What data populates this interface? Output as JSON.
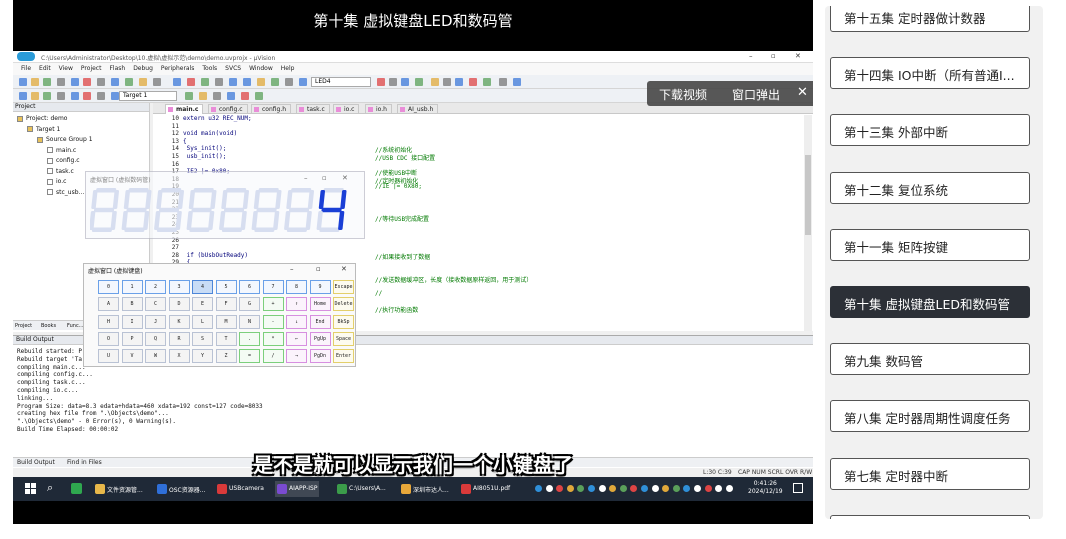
{
  "video": {
    "title": "第十集 虚拟键盘LED和数码管",
    "subtitle": "是不是就可以显示我们一个小键盘了",
    "controls": {
      "download": "下载视频",
      "popout": "窗口弹出",
      "close": "✕"
    }
  },
  "ide": {
    "window_title": "C:\\Users\\Administrator\\Desktop\\10.虚拟\\虚拟示范\\demo\\demo.uvprojx - µVision",
    "menu": [
      "File",
      "Edit",
      "View",
      "Project",
      "Flash",
      "Debug",
      "Peripherals",
      "Tools",
      "SVCS",
      "Window",
      "Help"
    ],
    "target_combo": "Target 1",
    "led_combo": "LED4",
    "project_pane": {
      "header": "Project",
      "items": [
        {
          "label": "Project: demo",
          "level": 0
        },
        {
          "label": "Target 1",
          "level": 1
        },
        {
          "label": "Source Group 1",
          "level": 2
        },
        {
          "label": "main.c",
          "level": 3
        },
        {
          "label": "config.c",
          "level": 3
        },
        {
          "label": "task.c",
          "level": 3
        },
        {
          "label": "io.c",
          "level": 3
        },
        {
          "label": "stc_usb...",
          "level": 3
        }
      ],
      "bottom_tabs": [
        "Project",
        "Books",
        "Func...",
        "Templ..."
      ]
    },
    "tabs": [
      "main.c",
      "config.c",
      "config.h",
      "task.c",
      "io.c",
      "io.h",
      "AI_usb.h"
    ],
    "code": [
      {
        "n": "10",
        "t": "extern u32 REC_NUM;",
        "c": ""
      },
      {
        "n": "11",
        "t": "",
        "c": ""
      },
      {
        "n": "12",
        "t": "void main(void)",
        "c": ""
      },
      {
        "n": "13",
        "t": "{",
        "c": ""
      },
      {
        "n": "14",
        "t": "    Sys_init();",
        "c": "//系统初始化"
      },
      {
        "n": "15",
        "t": "    usb_init();",
        "c": "//USB CDC 接口配置"
      },
      {
        "n": "16",
        "t": "",
        "c": ""
      },
      {
        "n": "17",
        "t": "    IE2 |= 0x80;",
        "c": "//使能USB中断"
      },
      {
        "n": "18",
        "t": "",
        "c": "//定时器初始化"
      },
      {
        "n": "19",
        "t": "",
        "c": "//IE |= 0X80;"
      },
      {
        "n": "20",
        "t": "",
        "c": ""
      },
      {
        "n": "21",
        "t": "",
        "c": ""
      },
      {
        "n": "22",
        "t": "",
        "c": ""
      },
      {
        "n": "23",
        "t": "",
        "c": "//等待USB完成配置"
      },
      {
        "n": "24",
        "t": "",
        "c": ""
      },
      {
        "n": "25",
        "t": "",
        "c": ""
      },
      {
        "n": "26",
        "t": "",
        "c": ""
      },
      {
        "n": "27",
        "t": "",
        "c": ""
      },
      {
        "n": "28",
        "t": "        if (bUsbOutReady)",
        "c": "//如果接收到了数据"
      },
      {
        "n": "29",
        "t": "        {",
        "c": ""
      },
      {
        "n": "30",
        "t": "            REC_NUM = UsbOutBuffer[5]-48;",
        "c": ""
      },
      {
        "n": "31",
        "t": "            //USB_SendData(UsbOutBuffer,OutNumber);",
        "c": "//发送数据缓冲区，长度（接收数据原样返回，用于测试）"
      },
      {
        "n": "32",
        "t": "",
        "c": ""
      },
      {
        "n": "33",
        "t": "",
        "c": "//"
      },
      {
        "n": "34",
        "t": "",
        "c": ""
      },
      {
        "n": "35",
        "t": "",
        "c": "//执行功能函数"
      }
    ],
    "build_output": {
      "header": "Build Output",
      "lines": [
        "Rebuild started: Project: demo",
        "Rebuild target 'Target 1'",
        "compiling main.c...",
        "compiling config.c...",
        "compiling task.c...",
        "compiling io.c...",
        "linking...",
        "Program Size: data=8.3 edata+hdata=460 xdata=192 const=127 code=8033",
        "creating hex file from \".\\Objects\\demo\"...",
        "\".\\Objects\\demo\" - 0 Error(s), 0 Warning(s).",
        "Build Time Elapsed:  00:00:02"
      ],
      "bottom_tabs": [
        "Build Output",
        "Find in Files"
      ]
    },
    "status": {
      "pos": "L:30 C:39",
      "flags": "CAP  NUM  SCRL  OVR  R/W"
    }
  },
  "led_window": {
    "title": "虚拟窗口 (虚拟数码管)",
    "digits": [
      "8",
      "8",
      "8",
      "8",
      "8",
      "8",
      "8",
      "4"
    ],
    "active_digit_index": 7,
    "on_color": "#1a3fd6",
    "off_color": "#d7def0"
  },
  "keyboard_window": {
    "title": "虚拟窗口 (虚拟键盘)",
    "rows": [
      [
        {
          "k": "0",
          "c": "bl"
        },
        {
          "k": "1",
          "c": "bl"
        },
        {
          "k": "2",
          "c": "bl"
        },
        {
          "k": "3",
          "c": "bl"
        },
        {
          "k": "4",
          "c": "act"
        },
        {
          "k": "5",
          "c": "bl"
        },
        {
          "k": "6",
          "c": "bl"
        },
        {
          "k": "7",
          "c": "bl"
        },
        {
          "k": "8",
          "c": "bl"
        },
        {
          "k": "9",
          "c": "bl"
        },
        {
          "k": "Escape",
          "c": "yl"
        }
      ],
      [
        {
          "k": "A",
          "c": ""
        },
        {
          "k": "B",
          "c": ""
        },
        {
          "k": "C",
          "c": ""
        },
        {
          "k": "D",
          "c": ""
        },
        {
          "k": "E",
          "c": ""
        },
        {
          "k": "F",
          "c": ""
        },
        {
          "k": "G",
          "c": ""
        },
        {
          "k": "+",
          "c": "gn"
        },
        {
          "k": "↑",
          "c": "pk"
        },
        {
          "k": "Home",
          "c": "pk"
        },
        {
          "k": "Delete",
          "c": "yl"
        }
      ],
      [
        {
          "k": "H",
          "c": ""
        },
        {
          "k": "I",
          "c": ""
        },
        {
          "k": "J",
          "c": ""
        },
        {
          "k": "K",
          "c": ""
        },
        {
          "k": "L",
          "c": ""
        },
        {
          "k": "M",
          "c": ""
        },
        {
          "k": "N",
          "c": ""
        },
        {
          "k": "-",
          "c": "gn"
        },
        {
          "k": "↓",
          "c": "pk"
        },
        {
          "k": "End",
          "c": "pk"
        },
        {
          "k": "BkSp",
          "c": "yl"
        }
      ],
      [
        {
          "k": "O",
          "c": ""
        },
        {
          "k": "P",
          "c": ""
        },
        {
          "k": "Q",
          "c": ""
        },
        {
          "k": "R",
          "c": ""
        },
        {
          "k": "S",
          "c": ""
        },
        {
          "k": "T",
          "c": ""
        },
        {
          "k": ".",
          "c": "gn"
        },
        {
          "k": "*",
          "c": "gn"
        },
        {
          "k": "←",
          "c": "pk"
        },
        {
          "k": "PgUp",
          "c": "pk"
        },
        {
          "k": "Space",
          "c": "yl"
        }
      ],
      [
        {
          "k": "U",
          "c": ""
        },
        {
          "k": "V",
          "c": ""
        },
        {
          "k": "W",
          "c": ""
        },
        {
          "k": "X",
          "c": ""
        },
        {
          "k": "Y",
          "c": ""
        },
        {
          "k": "Z",
          "c": ""
        },
        {
          "k": "=",
          "c": "gn"
        },
        {
          "k": "/",
          "c": "gn"
        },
        {
          "k": "→",
          "c": "pk"
        },
        {
          "k": "PgDn",
          "c": "pk"
        },
        {
          "k": "Enter",
          "c": "yl"
        }
      ]
    ]
  },
  "taskbar": {
    "items": [
      {
        "label": "文件资源管...",
        "color": "#e8b84a"
      },
      {
        "label": "OSC资源器...",
        "color": "#2f6fd8"
      },
      {
        "label": "USBcamera",
        "color": "#d93a3a"
      },
      {
        "label": "AIAPP-ISP",
        "color": "#7a4bd1"
      },
      {
        "label": "C:\\Users\\A...",
        "color": "#3b9c4a"
      },
      {
        "label": "深圳市达人...",
        "color": "#e8a83a"
      },
      {
        "label": "AI8051U.pdf",
        "color": "#d93a3a"
      }
    ],
    "time": "0:41:26",
    "date": "2024/12/19"
  },
  "playlist": {
    "episodes": [
      {
        "label": "第十五集 定时器做计数器",
        "active": false
      },
      {
        "label": "第十四集 IO中断（所有普通I...",
        "active": false
      },
      {
        "label": "第十三集 外部中断",
        "active": false
      },
      {
        "label": "第十二集 复位系统",
        "active": false
      },
      {
        "label": "第十一集 矩阵按键",
        "active": false
      },
      {
        "label": "第十集 虚拟键盘LED和数码管",
        "active": true
      },
      {
        "label": "第九集 数码管",
        "active": false
      },
      {
        "label": "第八集 定时器周期性调度任务",
        "active": false
      },
      {
        "label": "第七集 定时器中断",
        "active": false
      }
    ]
  }
}
